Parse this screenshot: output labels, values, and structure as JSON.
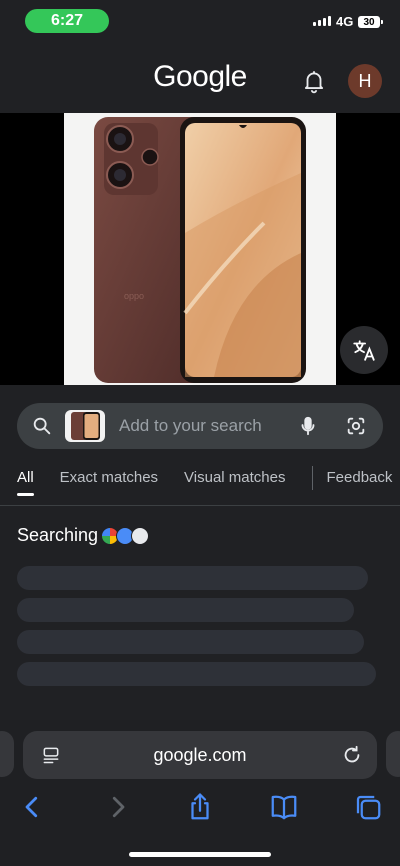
{
  "status_bar": {
    "time": "6:27",
    "network": "4G",
    "battery": "30"
  },
  "header": {
    "logo": "Google",
    "avatar_initial": "H"
  },
  "search": {
    "placeholder": "Add to your search"
  },
  "tabs": [
    {
      "label": "All",
      "active": true
    },
    {
      "label": "Exact matches",
      "active": false
    },
    {
      "label": "Visual matches",
      "active": false
    },
    {
      "label": "Feedback",
      "active": false
    }
  ],
  "results": {
    "status_text": "Searching"
  },
  "browser": {
    "url": "google.com"
  },
  "colors": {
    "background": "#202124",
    "status_pill": "#34c759",
    "accent_blue": "#4a8cf7",
    "avatar": "#6d3a2b"
  },
  "icons": {
    "bell": "bell-icon",
    "search": "search-icon",
    "mic": "mic-icon",
    "lens": "lens-camera-icon",
    "translate": "translate-icon",
    "reader": "reader-icon",
    "reload": "reload-icon",
    "back": "back-arrow-icon",
    "forward": "forward-arrow-icon",
    "share": "share-icon",
    "bookmarks": "bookmarks-icon",
    "tabs": "tabs-icon"
  }
}
